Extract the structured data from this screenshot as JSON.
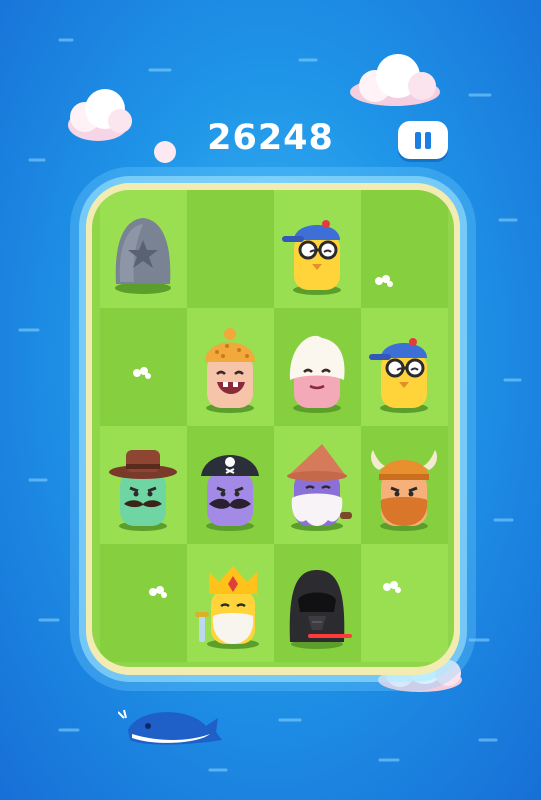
{
  "hud": {
    "score": "26248",
    "pause_icon": "pause-icon"
  },
  "board": {
    "rows": 4,
    "cols": 4,
    "pieces": [
      {
        "row": 0,
        "col": 0,
        "kind": "stone-with-star"
      },
      {
        "row": 0,
        "col": 2,
        "kind": "nerd-with-blue-cap-and-glasses"
      },
      {
        "row": 1,
        "col": 1,
        "kind": "baby-with-knit-beanie"
      },
      {
        "row": 1,
        "col": 2,
        "kind": "white-haired-elder"
      },
      {
        "row": 1,
        "col": 3,
        "kind": "nerd-with-blue-cap-and-glasses"
      },
      {
        "row": 2,
        "col": 0,
        "kind": "cowboy-with-mustache"
      },
      {
        "row": 2,
        "col": 1,
        "kind": "pirate-with-mustache"
      },
      {
        "row": 2,
        "col": 2,
        "kind": "wizard-with-long-beard"
      },
      {
        "row": 2,
        "col": 3,
        "kind": "viking-with-horned-helmet"
      },
      {
        "row": 3,
        "col": 1,
        "kind": "king-with-crown-and-sword"
      },
      {
        "row": 3,
        "col": 2,
        "kind": "dark-helmet-villain"
      }
    ]
  },
  "colors": {
    "ocean": "#1f95e8",
    "grass_light": "#9ade52",
    "grass_dark": "#86d040",
    "sand": "#f3ecb2",
    "score_text": "#ffffff"
  }
}
